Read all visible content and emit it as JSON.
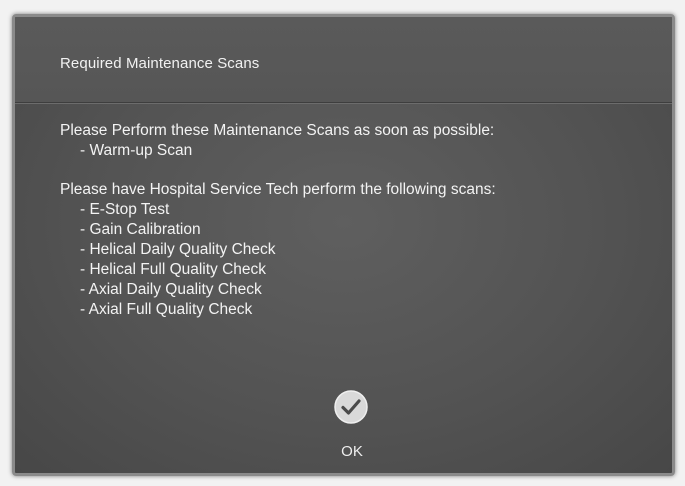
{
  "dialog": {
    "title": "Required Maintenance Scans",
    "section1_heading": "Please Perform these Maintenance Scans as soon as possible:",
    "section1_items": [
      "- Warm-up Scan"
    ],
    "section2_heading": "Please have Hospital Service Tech perform the following scans:",
    "section2_items": [
      "- E-Stop Test",
      "- Gain Calibration",
      "- Helical Daily Quality Check",
      "- Helical Full Quality Check",
      "- Axial Daily Quality Check",
      "- Axial Full Quality Check"
    ],
    "ok_label": "OK"
  },
  "colors": {
    "dialog_background": "#555555",
    "text": "#f3f3f3",
    "ok_icon": "#d9d9d9"
  },
  "icons": {
    "ok": "checkmark-circle-icon"
  }
}
